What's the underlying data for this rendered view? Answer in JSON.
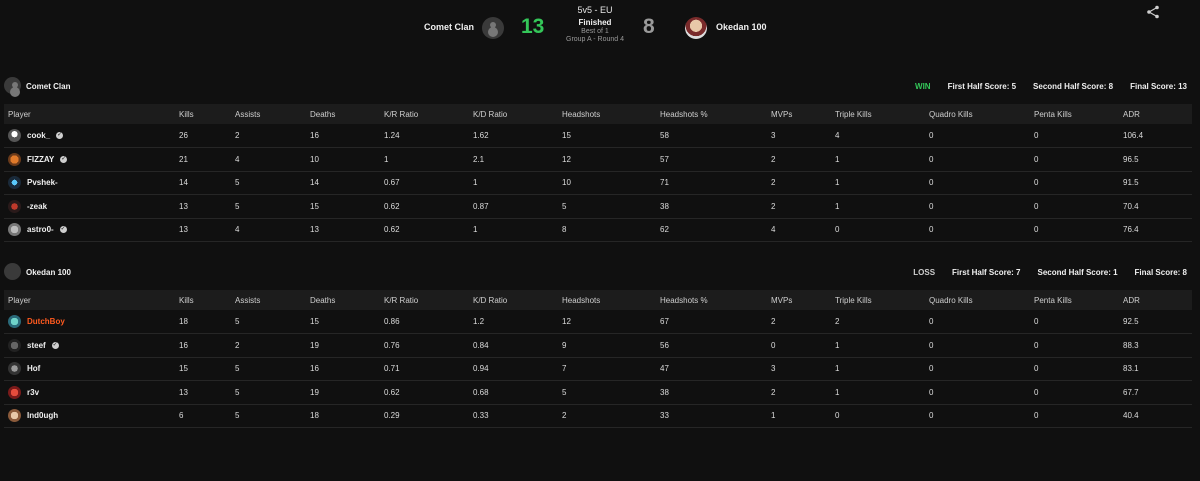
{
  "match": {
    "format": "5v5 - EU",
    "status": "Finished",
    "best_of": "Best of 1",
    "round": "Group A - Round 4",
    "left_team": "Comet Clan",
    "right_team": "Okedan 100",
    "left_score": "13",
    "right_score": "8",
    "accent_win": "#34c759",
    "accent_highlight": "#ff5a1f"
  },
  "icons": {
    "share": "share-icon"
  },
  "columns": [
    "Player",
    "Kills",
    "Assists",
    "Deaths",
    "K/R Ratio",
    "K/D Ratio",
    "Headshots",
    "Headshots %",
    "MVPs",
    "Triple Kills",
    "Quadro Kills",
    "Penta Kills",
    "ADR"
  ],
  "teams": [
    {
      "name": "Comet Clan",
      "result": "WIN",
      "first_half": "First Half Score: 5",
      "second_half": "Second Half Score: 8",
      "final": "Final Score: 13",
      "players": [
        {
          "name": "cook_",
          "verified": "✓",
          "stats": [
            "26",
            "2",
            "16",
            "1.24",
            "1.62",
            "15",
            "58",
            "3",
            "4",
            "0",
            "0",
            "106.4"
          ]
        },
        {
          "name": "FIZZAY",
          "verified": "✓",
          "stats": [
            "21",
            "4",
            "10",
            "1",
            "2.1",
            "12",
            "57",
            "2",
            "1",
            "0",
            "0",
            "96.5"
          ]
        },
        {
          "name": "Pvshek-",
          "verified": "",
          "stats": [
            "14",
            "5",
            "14",
            "0.67",
            "1",
            "10",
            "71",
            "2",
            "1",
            "0",
            "0",
            "91.5"
          ]
        },
        {
          "name": "-zeak",
          "verified": "",
          "stats": [
            "13",
            "5",
            "15",
            "0.62",
            "0.87",
            "5",
            "38",
            "2",
            "1",
            "0",
            "0",
            "70.4"
          ]
        },
        {
          "name": "astro0-",
          "verified": "✓",
          "stats": [
            "13",
            "4",
            "13",
            "0.62",
            "1",
            "8",
            "62",
            "4",
            "0",
            "0",
            "0",
            "76.4"
          ]
        }
      ]
    },
    {
      "name": "Okedan 100",
      "result": "LOSS",
      "first_half": "First Half Score: 7",
      "second_half": "Second Half Score: 1",
      "final": "Final Score: 8",
      "players": [
        {
          "name": "DutchBoy",
          "verified": "",
          "stats": [
            "18",
            "5",
            "15",
            "0.86",
            "1.2",
            "12",
            "67",
            "2",
            "2",
            "0",
            "0",
            "92.5"
          ]
        },
        {
          "name": "steef",
          "verified": "✓",
          "stats": [
            "16",
            "2",
            "19",
            "0.76",
            "0.84",
            "9",
            "56",
            "0",
            "1",
            "0",
            "0",
            "88.3"
          ]
        },
        {
          "name": "Hof",
          "verified": "",
          "stats": [
            "15",
            "5",
            "16",
            "0.71",
            "0.94",
            "7",
            "47",
            "3",
            "1",
            "0",
            "0",
            "83.1"
          ]
        },
        {
          "name": "r3v",
          "verified": "",
          "stats": [
            "13",
            "5",
            "19",
            "0.62",
            "0.68",
            "5",
            "38",
            "2",
            "1",
            "0",
            "0",
            "67.7"
          ]
        },
        {
          "name": "Ind0ugh",
          "verified": "",
          "stats": [
            "6",
            "5",
            "18",
            "0.29",
            "0.33",
            "2",
            "33",
            "1",
            "0",
            "0",
            "0",
            "40.4"
          ]
        }
      ]
    }
  ]
}
